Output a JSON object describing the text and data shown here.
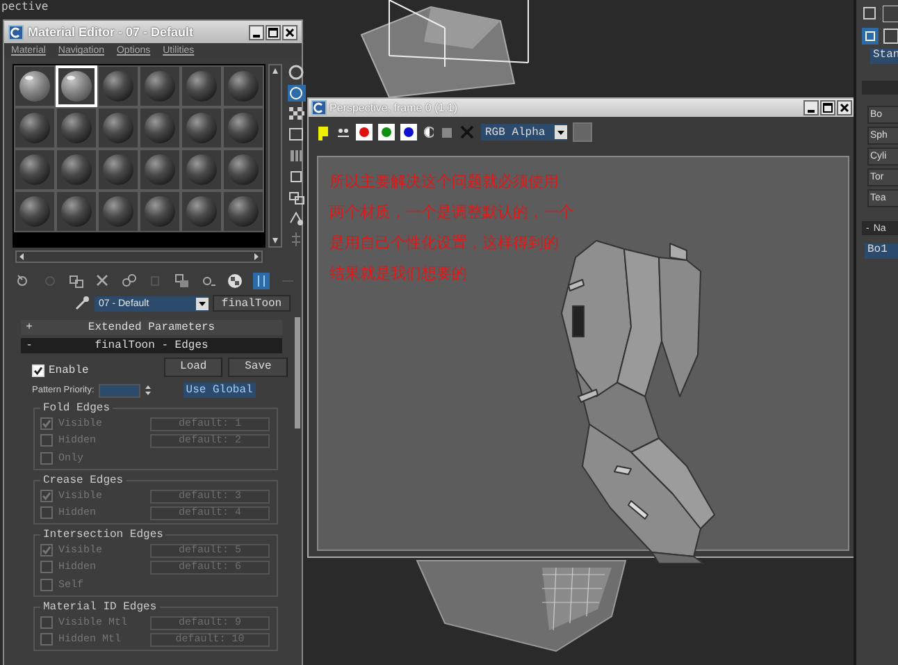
{
  "viewport_label": "pective",
  "material_editor": {
    "title": "Material Editor - 07 - Default",
    "menu": [
      "Material",
      "Navigation",
      "Options",
      "Utilities"
    ],
    "slots": [
      {
        "assigned": true,
        "selected": false
      },
      {
        "assigned": true,
        "selected": true
      },
      {
        "assigned": false,
        "selected": false
      },
      {
        "assigned": false,
        "selected": false
      },
      {
        "assigned": false,
        "selected": false
      },
      {
        "assigned": false,
        "selected": false
      },
      {
        "assigned": false,
        "selected": false
      },
      {
        "assigned": false,
        "selected": false
      },
      {
        "assigned": false,
        "selected": false
      },
      {
        "assigned": false,
        "selected": false
      },
      {
        "assigned": false,
        "selected": false
      },
      {
        "assigned": false,
        "selected": false
      },
      {
        "assigned": false,
        "selected": false
      },
      {
        "assigned": false,
        "selected": false
      },
      {
        "assigned": false,
        "selected": false
      },
      {
        "assigned": false,
        "selected": false
      },
      {
        "assigned": false,
        "selected": false
      },
      {
        "assigned": false,
        "selected": false
      },
      {
        "assigned": false,
        "selected": false
      },
      {
        "assigned": false,
        "selected": false
      },
      {
        "assigned": false,
        "selected": false
      },
      {
        "assigned": false,
        "selected": false
      },
      {
        "assigned": false,
        "selected": false
      },
      {
        "assigned": false,
        "selected": false
      }
    ],
    "material_name": "07 - Default",
    "material_type": "finalToon",
    "rollouts": [
      {
        "sign": "+",
        "title": "Extended Parameters",
        "expanded": false
      },
      {
        "sign": "-",
        "title": "finalToon - Edges",
        "expanded": true
      }
    ],
    "enable": {
      "label": "Enable",
      "checked": true
    },
    "buttons": [
      "Load",
      "Save"
    ],
    "pattern_priority": {
      "label": "Pattern Priority:"
    },
    "use_global": "Use Global",
    "groups": [
      {
        "title": "Fold Edges",
        "rows": [
          {
            "label": "Visible",
            "checked": true,
            "disabled": true,
            "button": "default: 1"
          },
          {
            "label": "Hidden",
            "checked": false,
            "disabled": true,
            "button": "default: 2"
          },
          {
            "label": "Only",
            "checked": false,
            "disabled": true
          }
        ]
      },
      {
        "title": "Crease Edges",
        "rows": [
          {
            "label": "Visible",
            "checked": true,
            "disabled": true,
            "button": "default: 3"
          },
          {
            "label": "Hidden",
            "checked": false,
            "disabled": true,
            "button": "default: 4"
          }
        ]
      },
      {
        "title": "Intersection Edges",
        "rows": [
          {
            "label": "Visible",
            "checked": true,
            "disabled": true,
            "button": "default: 5"
          },
          {
            "label": "Hidden",
            "checked": false,
            "disabled": true,
            "button": "default: 6"
          },
          {
            "label": "Self",
            "checked": false,
            "disabled": true
          }
        ]
      },
      {
        "title": "Material ID Edges",
        "rows": [
          {
            "label": "Visible Mtl",
            "checked": false,
            "disabled": true,
            "button": "default: 9"
          },
          {
            "label": "Hidden Mtl",
            "checked": false,
            "disabled": true,
            "button": "default: 10"
          }
        ]
      }
    ]
  },
  "frame_window": {
    "title": "Perspective, frame 0 (1:1)",
    "channels": [
      {
        "color": "#e01010"
      },
      {
        "color": "#109010"
      },
      {
        "color": "#1010d0"
      }
    ],
    "display_channel": "RGB Alpha",
    "note_lines": [
      "所以主要解决这个问题就必须使用",
      "两个材质，一个是调整默认的，一个",
      "是用自己个性化设置，这样得到的",
      "结果就是我们想要的"
    ]
  },
  "command_panel": {
    "type_field": "Stan",
    "object_buttons": [
      "Bo",
      "Sph",
      "Cyli",
      "Tor",
      "Tea"
    ],
    "name_rollout": {
      "sign": "-",
      "title": "Na"
    },
    "name_field": "Bo1"
  }
}
